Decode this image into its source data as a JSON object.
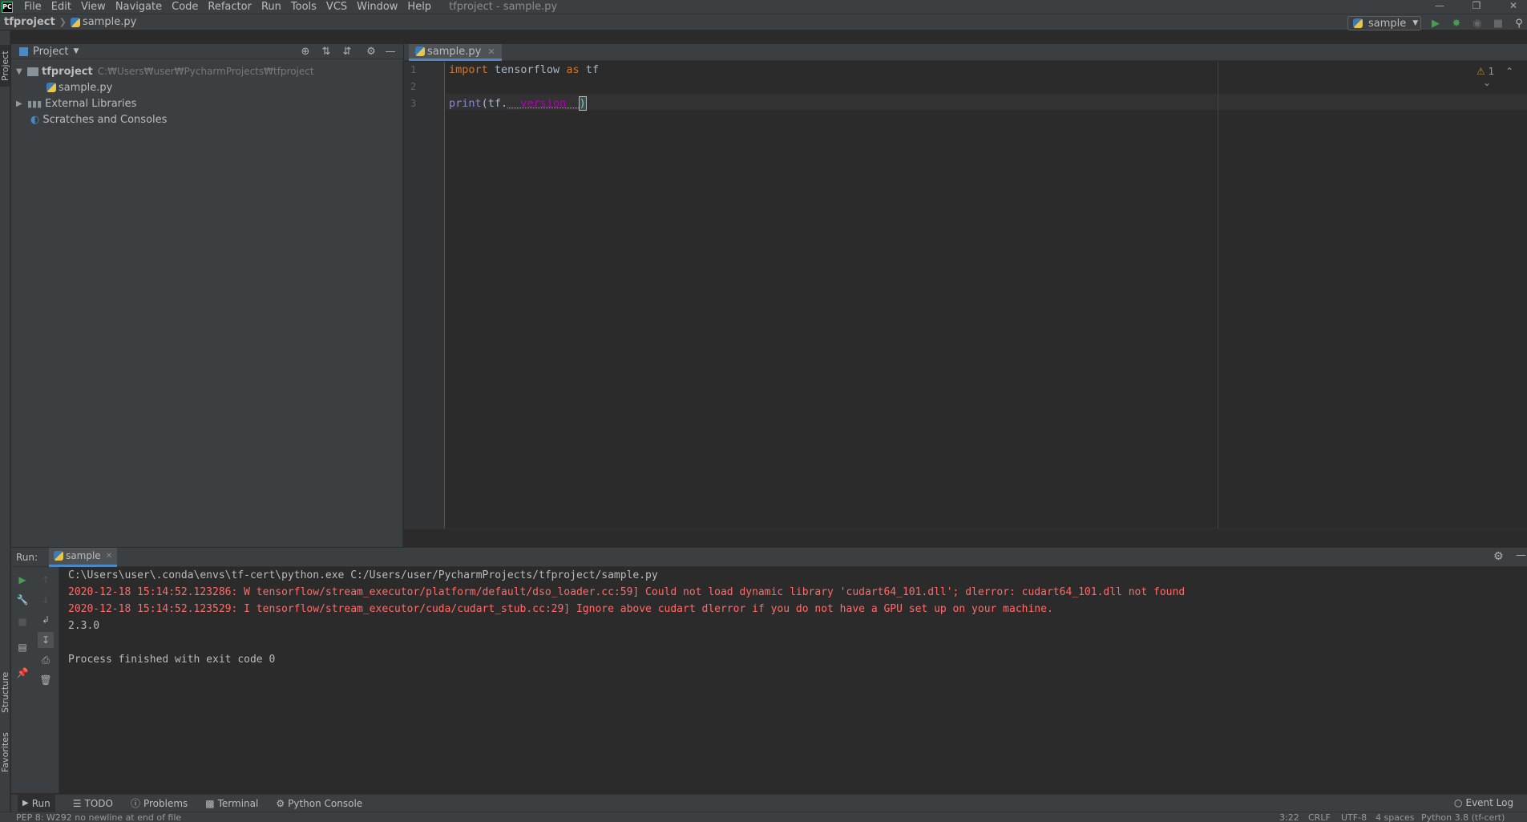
{
  "menubar": {
    "logo": "PC",
    "items": [
      "File",
      "Edit",
      "View",
      "Navigate",
      "Code",
      "Refactor",
      "Run",
      "Tools",
      "VCS",
      "Window",
      "Help"
    ],
    "window_title": "tfproject - sample.py"
  },
  "navbar": {
    "project": "tfproject",
    "file": "sample.py",
    "run_config": "sample"
  },
  "left_stripe": {
    "project_tab": "Project",
    "structure_tab": "Structure",
    "favorites_tab": "Favorites"
  },
  "project_panel": {
    "title": "Project",
    "tree": {
      "root_name": "tfproject",
      "root_path": "C:₩Users₩user₩PycharmProjects₩tfproject",
      "file": "sample.py",
      "external_libraries": "External Libraries",
      "scratches": "Scratches and Consoles"
    }
  },
  "editor": {
    "tab_label": "sample.py",
    "line_numbers": [
      "1",
      "2",
      "3"
    ],
    "warning_count": "1",
    "code": {
      "line1_kw": "import",
      "line1_mod": " tensorflow ",
      "line1_as": "as",
      "line1_alias": " tf",
      "line3_print": "print",
      "line3_open": "(tf.",
      "line3_attr": "__version__",
      "line3_close": ")"
    }
  },
  "run_panel": {
    "label": "Run:",
    "tab": "sample",
    "console": [
      {
        "text": "C:\\Users\\user\\.conda\\envs\\tf-cert\\python.exe C:/Users/user/PycharmProjects/tfproject/sample.py",
        "kind": "normal"
      },
      {
        "text": "2020-12-18 15:14:52.123286: W tensorflow/stream_executor/platform/default/dso_loader.cc:59] Could not load dynamic library 'cudart64_101.dll'; dlerror: cudart64_101.dll not found",
        "kind": "err"
      },
      {
        "text": "2020-12-18 15:14:52.123529: I tensorflow/stream_executor/cuda/cudart_stub.cc:29] Ignore above cudart dlerror if you do not have a GPU set up on your machine.",
        "kind": "err"
      },
      {
        "text": "2.3.0",
        "kind": "normal"
      },
      {
        "text": "",
        "kind": "normal"
      },
      {
        "text": "Process finished with exit code 0",
        "kind": "normal"
      }
    ]
  },
  "bottom_tools": {
    "run": "Run",
    "todo": "TODO",
    "problems": "Problems",
    "terminal": "Terminal",
    "python_console": "Python Console",
    "event_log": "Event Log"
  },
  "statusbar": {
    "message": "PEP 8: W292 no newline at end of file",
    "position": "3:22",
    "line_sep": "CRLF",
    "encoding": "UTF-8",
    "indent": "4 spaces",
    "interpreter": "Python 3.8 (tf-cert)"
  },
  "colors": {
    "keyword": "#cc7832",
    "magic": "#b200b2",
    "error": "#ff6b68",
    "run_green": "#499c54"
  }
}
